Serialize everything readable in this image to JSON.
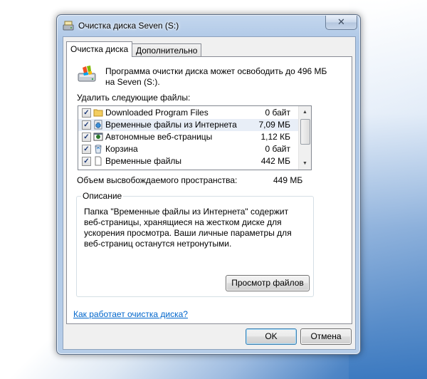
{
  "window": {
    "title": "Очистка диска Seven (S:)",
    "close_symbol": "✕"
  },
  "tabs": [
    {
      "label": "Очистка диска",
      "active": true
    },
    {
      "label": "Дополнительно",
      "active": false
    }
  ],
  "intro": {
    "text": "Программа очистки диска может освободить до 496 МБ на Seven (S:)."
  },
  "files": {
    "label": "Удалить следующие файлы:",
    "rows": [
      {
        "checked": true,
        "icon": "folder-icon",
        "name": "Downloaded Program Files",
        "size": "0 байт"
      },
      {
        "checked": true,
        "icon": "internet-files-icon",
        "name": "Временные файлы из Интернета",
        "size": "7,09 МБ"
      },
      {
        "checked": true,
        "icon": "offline-pages-icon",
        "name": "Автономные веб-страницы",
        "size": "1,12 КБ"
      },
      {
        "checked": true,
        "icon": "recycle-bin-icon",
        "name": "Корзина",
        "size": "0 байт"
      },
      {
        "checked": true,
        "icon": "document-icon",
        "name": "Временные файлы",
        "size": "442 МБ"
      }
    ],
    "check_symbol": "✓",
    "selected_index": 1
  },
  "total": {
    "label": "Объем высвобождаемого пространства:",
    "value": "449 МБ"
  },
  "description": {
    "legend": "Описание",
    "text": "Папка \"Временные файлы из Интернета\" содержит веб-страницы, хранящиеся на жестком диске для ускорения просмотра. Ваши личные параметры для веб-страниц останутся нетронутыми.",
    "view_button": "Просмотр файлов"
  },
  "help_link": "Как работает очистка диска?",
  "buttons": {
    "ok": "OK",
    "cancel": "Отмена"
  },
  "scrollbar": {
    "up_symbol": "▲",
    "down_symbol": "▼"
  }
}
